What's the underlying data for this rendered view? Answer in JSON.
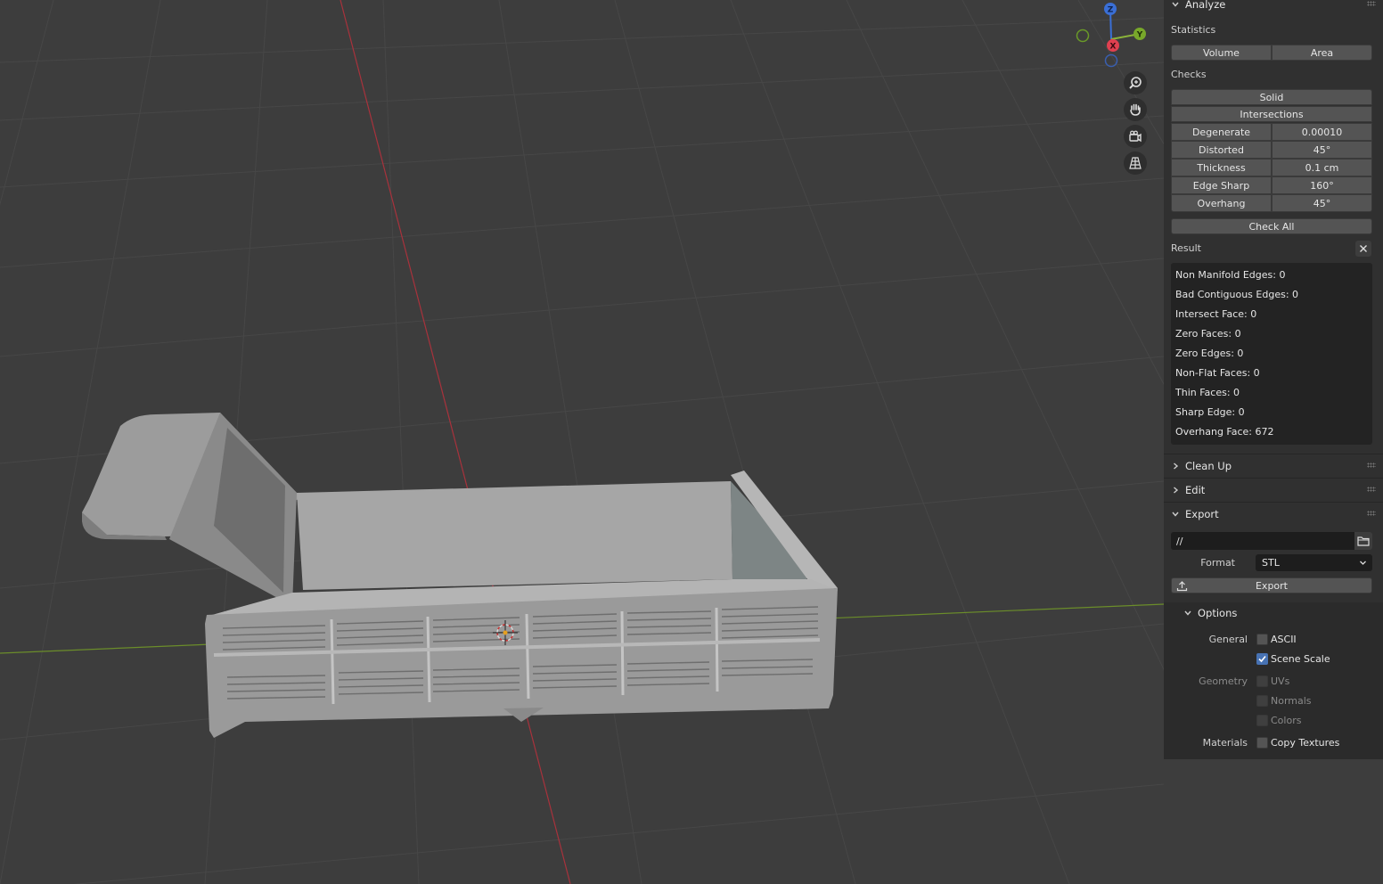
{
  "navigation": {
    "axes": {
      "z": "Z",
      "y": "Y",
      "x": "X"
    },
    "tools": [
      "zoom-icon",
      "pan-hand-icon",
      "camera-icon",
      "perspective-grid-icon"
    ]
  },
  "analyze": {
    "title": "Analyze",
    "statistics_label": "Statistics",
    "volume_btn": "Volume",
    "area_btn": "Area",
    "checks_label": "Checks",
    "solid_btn": "Solid",
    "intersections_btn": "Intersections",
    "params": [
      {
        "label": "Degenerate",
        "value": "0.00010"
      },
      {
        "label": "Distorted",
        "value": "45°"
      },
      {
        "label": "Thickness",
        "value": "0.1 cm"
      },
      {
        "label": "Edge Sharp",
        "value": "160°"
      },
      {
        "label": "Overhang",
        "value": "45°"
      }
    ],
    "check_all_btn": "Check All",
    "result_label": "Result",
    "results": [
      "Non Manifold Edges: 0",
      "Bad Contiguous Edges: 0",
      "Intersect Face: 0",
      "Zero Faces: 0",
      "Zero Edges: 0",
      "Non-Flat Faces: 0",
      "Thin Faces: 0",
      "Sharp Edge: 0",
      "Overhang Face: 672"
    ]
  },
  "cleanup": {
    "title": "Clean Up"
  },
  "edit": {
    "title": "Edit"
  },
  "export": {
    "title": "Export",
    "path": "//",
    "format_label": "Format",
    "format_value": "STL",
    "export_btn": "Export",
    "options_title": "Options",
    "general_label": "General",
    "ascii_label": "ASCII",
    "ascii_checked": false,
    "scene_scale_label": "Scene Scale",
    "scene_scale_checked": true,
    "geometry_label": "Geometry",
    "uvs_label": "UVs",
    "normals_label": "Normals",
    "colors_label": "Colors",
    "materials_label": "Materials",
    "copy_textures_label": "Copy Textures",
    "copy_textures_checked": false
  }
}
